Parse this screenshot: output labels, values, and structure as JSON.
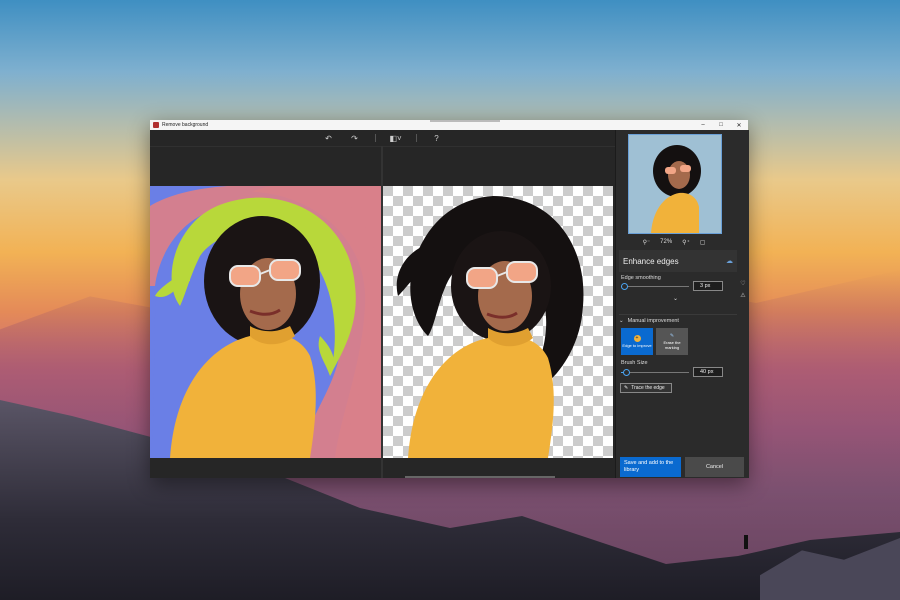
{
  "window": {
    "title": "Remove background"
  },
  "toolbar": {
    "undo_icon": "undo-icon",
    "redo_icon": "redo-icon",
    "compare_icon": "compare-icon",
    "help_icon": "help-icon"
  },
  "preview": {
    "zoom_level": "72%"
  },
  "enhance_edges": {
    "title": "Enhance edges",
    "smoothing_label": "Edge smoothing",
    "smoothing_value": "3 px",
    "smoothing_fraction": 0.05
  },
  "manual_improvement": {
    "title": "Manual improvement",
    "edge_btn": "Edge to improve",
    "erase_btn": "Erase the marking",
    "brush_label": "Brush Size",
    "brush_value": "40 px",
    "brush_fraction": 0.08,
    "trace_label": "Trace the edge"
  },
  "footer": {
    "save_label": "Save and add to the library",
    "cancel_label": "Cancel"
  },
  "colors": {
    "accent": "#0a6ad0",
    "mask_green": "#b8d83a",
    "mask_pink": "#d9808a",
    "mask_blue": "#6a7fe6",
    "sweater": "#f1b23a"
  }
}
